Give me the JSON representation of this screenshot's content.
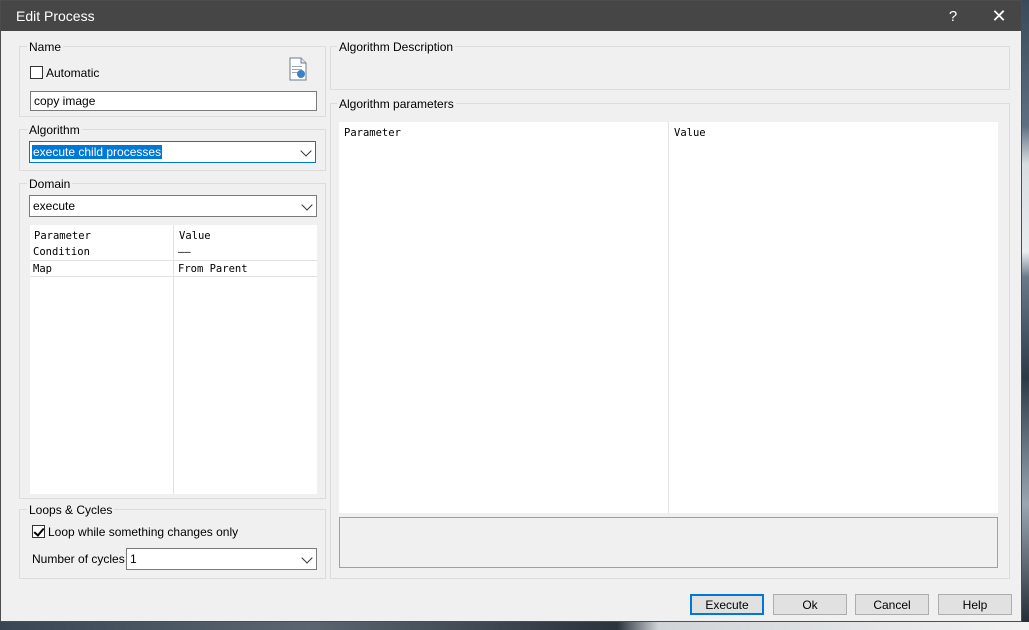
{
  "window": {
    "title": "Edit Process",
    "help_glyph": "?",
    "close_glyph": "✕"
  },
  "name_group": {
    "label": "Name",
    "automatic_label": "Automatic",
    "automatic_checked": false,
    "name_value": "copy image"
  },
  "algorithm_group": {
    "label": "Algorithm",
    "selected": "execute child processes"
  },
  "domain_group": {
    "label": "Domain",
    "selected": "execute",
    "columns": [
      "Parameter",
      "Value"
    ],
    "rows": [
      {
        "parameter": "Condition",
        "value": "——"
      },
      {
        "parameter": "Map",
        "value": "From Parent"
      }
    ]
  },
  "loops_group": {
    "label": "Loops & Cycles",
    "loop_label": "Loop while something changes only",
    "loop_checked": true,
    "cycles_label": "Number of cycles",
    "cycles_value": "1"
  },
  "description_group": {
    "label": "Algorithm Description"
  },
  "parameters_group": {
    "label": "Algorithm parameters",
    "columns": [
      "Parameter",
      "Value"
    ]
  },
  "buttons": {
    "execute": "Execute",
    "ok": "Ok",
    "cancel": "Cancel",
    "help": "Help"
  },
  "colors": {
    "titlebar": "#464646",
    "accent": "#0078d7",
    "dialog_bg": "#f0f0f0"
  }
}
